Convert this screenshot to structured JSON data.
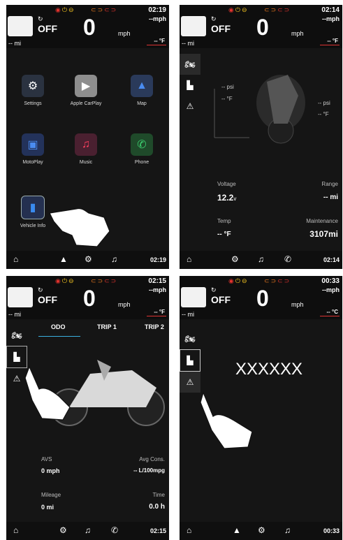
{
  "common": {
    "status_icons": [
      "◉",
      "⏻",
      "⊖",
      "⊂⊃",
      "⊂⊃"
    ],
    "off": "OFF",
    "speed": "0",
    "unit": "mph",
    "small_speed": "--mph",
    "fuel": "-- mi",
    "cc_icon": "↻"
  },
  "s1": {
    "time": "02:19",
    "temp": "-- °F",
    "apps": [
      {
        "label": "Settings",
        "icon": "⚙"
      },
      {
        "label": "Apple CarPlay",
        "icon": "▶"
      },
      {
        "label": "Map",
        "icon": "▲"
      },
      {
        "label": "MotoPlay",
        "icon": "▣"
      },
      {
        "label": "Music",
        "icon": "♫"
      },
      {
        "label": "Phone",
        "icon": "✆"
      },
      {
        "label": "Vehicle Info",
        "icon": "▮"
      }
    ],
    "nav_time": "02:19"
  },
  "s2": {
    "time": "02:14",
    "temp": "-- °F",
    "tire_left": "-- psi",
    "tire_left_temp": "-- °F",
    "tire_right": "-- psi",
    "tire_right_temp": "-- °F",
    "voltage_label": "Voltage",
    "voltage": "12.2",
    "voltage_unit": "v",
    "range_label": "Range",
    "range": "-- mi",
    "temp_label": "Temp",
    "temp_val": "-- °F",
    "maint_label": "Maintenance",
    "maint": "3107mi",
    "nav_time": "02:14"
  },
  "s3": {
    "time": "02:15",
    "temp": "-- °F",
    "tabs": [
      "ODO",
      "TRIP 1",
      "TRIP 2"
    ],
    "avs_label": "AVS",
    "avs": "0 mph",
    "avg_label": "Avg Cons.",
    "avg": "-- L/100mpg",
    "mileage_label": "Mileage",
    "mileage": "0 mi",
    "time_label": "Time",
    "time_val": "0.0 h",
    "nav_time": "02:15"
  },
  "s4": {
    "time": "00:33",
    "temp": "-- °C",
    "placeholder": "XXXXXX",
    "nav_time": "00:33"
  }
}
